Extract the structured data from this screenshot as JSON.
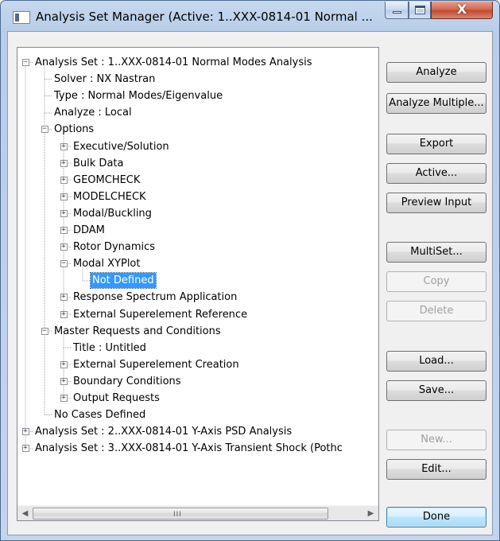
{
  "window": {
    "title": "Analysis Set Manager (Active: 1..XXX-0814-01 Normal ...",
    "close_symbol": "X"
  },
  "tree": {
    "nodes": [
      {
        "label": "Analysis Set : 1..XXX-0814-01 Normal Modes Analysis",
        "toggle": "−"
      },
      {
        "label": "Solver : NX Nastran",
        "toggle": ""
      },
      {
        "label": "Type : Normal Modes/Eigenvalue",
        "toggle": ""
      },
      {
        "label": "Analyze : Local",
        "toggle": ""
      },
      {
        "label": "Options",
        "toggle": "−"
      },
      {
        "label": "Executive/Solution",
        "toggle": "+"
      },
      {
        "label": "Bulk Data",
        "toggle": "+"
      },
      {
        "label": "GEOMCHECK",
        "toggle": "+"
      },
      {
        "label": "MODELCHECK",
        "toggle": "+"
      },
      {
        "label": "Modal/Buckling",
        "toggle": "+"
      },
      {
        "label": "DDAM",
        "toggle": "+"
      },
      {
        "label": "Rotor Dynamics",
        "toggle": "+"
      },
      {
        "label": "Modal XYPlot",
        "toggle": "−"
      },
      {
        "label": "Not Defined",
        "toggle": "",
        "selected": true
      },
      {
        "label": "Response Spectrum Application",
        "toggle": "+"
      },
      {
        "label": "External Superelement Reference",
        "toggle": "+"
      },
      {
        "label": "Master Requests and Conditions",
        "toggle": "−"
      },
      {
        "label": "Title : Untitled",
        "toggle": ""
      },
      {
        "label": "External Superelement Creation",
        "toggle": "+"
      },
      {
        "label": "Boundary Conditions",
        "toggle": "+"
      },
      {
        "label": "Output Requests",
        "toggle": "+"
      },
      {
        "label": "No Cases Defined",
        "toggle": ""
      },
      {
        "label": "Analysis Set : 2..XXX-0814-01 Y-Axis PSD Analysis",
        "toggle": "+"
      },
      {
        "label": "Analysis Set : 3..XXX-0814-01 Y-Axis Transient Shock (Pothc",
        "toggle": "+"
      }
    ]
  },
  "scrollbar": {
    "left_arrow": "◀",
    "right_arrow": "▶",
    "grip": "III"
  },
  "buttons": {
    "analyze": "Analyze",
    "analyze_multiple": "Analyze Multiple...",
    "export": "Export",
    "active": "Active...",
    "preview_input": "Preview Input",
    "multiset": "MultiSet...",
    "copy": "Copy",
    "delete": "Delete",
    "load": "Load...",
    "save": "Save...",
    "new": "New...",
    "edit": "Edit...",
    "done": "Done"
  }
}
